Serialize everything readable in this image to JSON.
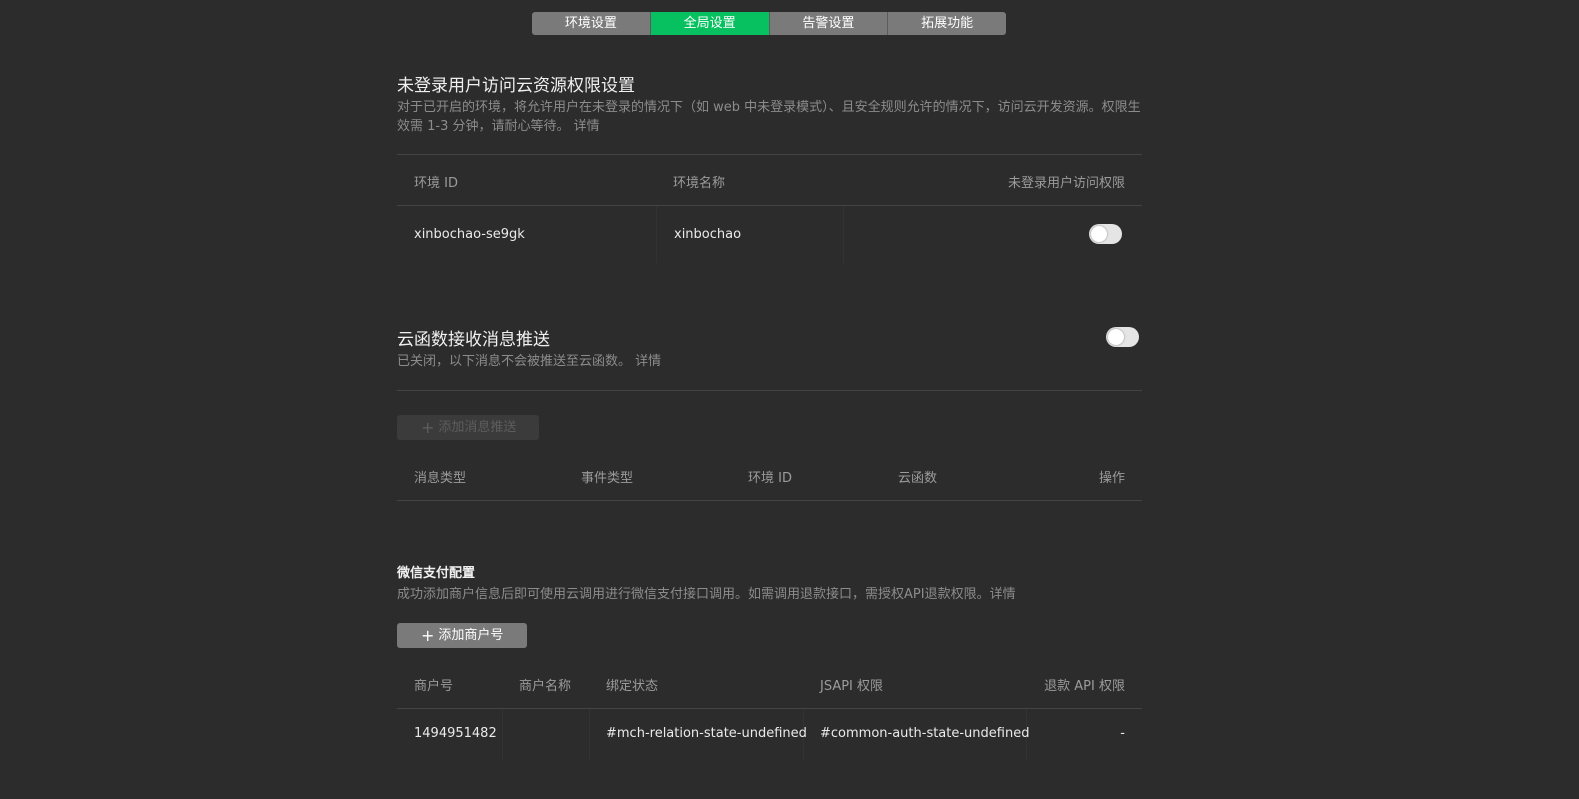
{
  "tabs": [
    {
      "label": "环境设置",
      "active": false
    },
    {
      "label": "全局设置",
      "active": true
    },
    {
      "label": "告警设置",
      "active": false
    },
    {
      "label": "拓展功能",
      "active": false
    }
  ],
  "colors": {
    "accent": "#07c160",
    "background": "#2c2c2c"
  },
  "unauth_section": {
    "title": "未登录用户访问云资源权限设置",
    "desc_line1": "对于已开启的环境，将允许用户在未登录的情况下（如 web 中未登录模式）、且安全规则允许的情况下，访问云开发资源。权限生",
    "desc_line2": "效需 1-3 分钟，请耐心等待。 详情",
    "columns": [
      "环境 ID",
      "环境名称",
      "未登录用户访问权限"
    ],
    "rows": [
      {
        "env_id": "xinbochao-se9gk",
        "env_name": "xinbochao",
        "access_enabled": false
      }
    ]
  },
  "push_section": {
    "title": "云函数接收消息推送",
    "desc": "已关闭，以下消息不会被推送至云函数。 详情",
    "enabled": false,
    "add_button": "添加消息推送",
    "columns": [
      "消息类型",
      "事件类型",
      "环境 ID",
      "云函数",
      "操作"
    ]
  },
  "pay_section": {
    "title": "微信支付配置",
    "desc": "成功添加商户信息后即可使用云调用进行微信支付接口调用。如需调用退款接口，需授权API退款权限。详情",
    "add_button": "添加商户号",
    "columns": [
      "商户号",
      "商户名称",
      "绑定状态",
      "JSAPI 权限",
      "退款 API 权限"
    ],
    "rows": [
      {
        "mch_id": "1494951482",
        "mch_name": "",
        "bind_state": "#mch-relation-state-undefined",
        "jsapi": "#common-auth-state-undefined",
        "refund_api": "-"
      }
    ]
  }
}
